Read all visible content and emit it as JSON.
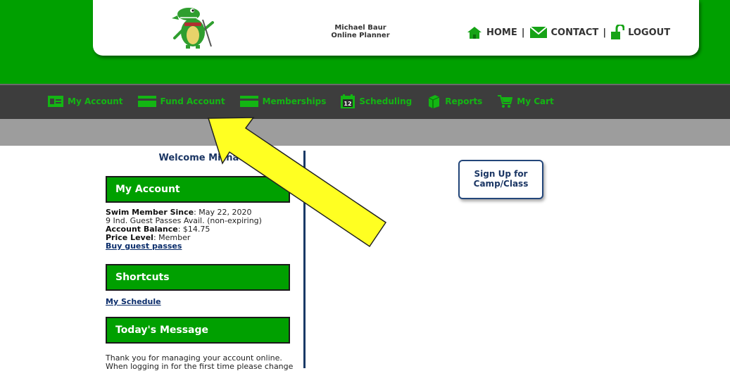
{
  "header": {
    "site_name_line1": "Michael Baur",
    "site_name_line2": "Online Planner",
    "links": [
      {
        "label": "HOME",
        "icon": "house-icon"
      },
      {
        "label": "CONTACT",
        "icon": "envelope-icon"
      },
      {
        "label": "LOGOUT",
        "icon": "padlock-open-icon"
      }
    ],
    "separator": "|"
  },
  "nav": {
    "items": [
      {
        "label": "My Account",
        "icon": "id-card-icon"
      },
      {
        "label": "Fund Account",
        "icon": "credit-card-icon"
      },
      {
        "label": "Memberships",
        "icon": "membership-card-icon"
      },
      {
        "label": "Scheduling",
        "icon": "calendar-icon"
      },
      {
        "label": "Reports",
        "icon": "book-icon"
      },
      {
        "label": "My Cart",
        "icon": "cart-icon"
      }
    ],
    "calendar_day": "12"
  },
  "sidebar": {
    "welcome": "Welcome Michael",
    "my_account": {
      "title": "My Account",
      "member_since_label": "Swim Member Since",
      "member_since_value": ": May 22, 2020",
      "guest_passes": "9 Ind. Guest Passes Avail. (non-expiring)",
      "balance_label": "Account Balance",
      "balance_value": ": $14.75",
      "price_level_label": "Price Level",
      "price_level_value": ": Member",
      "buy_link": "Buy guest passes"
    },
    "shortcuts": {
      "title": "Shortcuts",
      "link": "My Schedule"
    },
    "message": {
      "title": "Today's Message",
      "line1": "Thank you for managing your account online.",
      "line2": "When logging in for the first time please change"
    }
  },
  "main": {
    "signup_line1": "Sign Up for",
    "signup_line2": "Camp/Class"
  },
  "colors": {
    "brand_green": "#00a000",
    "nav_bg": "#3d3d3d",
    "nav_text": "#13b613",
    "navy": "#1b3664",
    "arrow_fill": "#ffff22"
  }
}
